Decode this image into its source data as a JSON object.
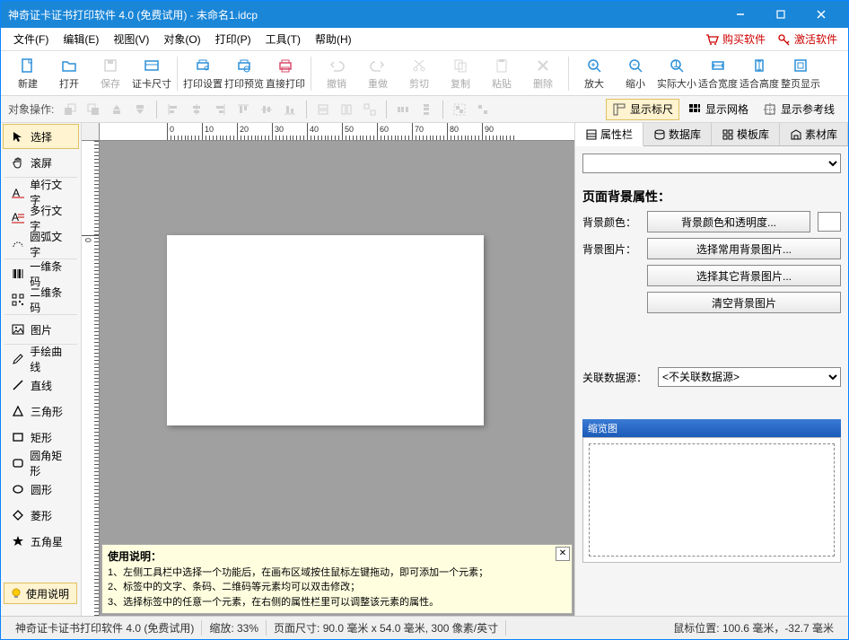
{
  "titlebar": {
    "title": "神奇证卡证书打印软件 4.0 (免费试用) - 未命名1.idcp"
  },
  "menu": {
    "file": "文件(F)",
    "edit": "编辑(E)",
    "view": "视图(V)",
    "object": "对象(O)",
    "print": "打印(P)",
    "tool": "工具(T)",
    "help": "帮助(H)",
    "buy": "购买软件",
    "activate": "激活软件"
  },
  "toolbar": {
    "new": "新建",
    "open": "打开",
    "save": "保存",
    "cardsize": "证卡尺寸",
    "printsetup": "打印设置",
    "printpreview": "打印预览",
    "printnow": "直接打印",
    "undo": "撤销",
    "redo": "重做",
    "cut": "剪切",
    "copy": "复制",
    "paste": "粘贴",
    "delete": "删除",
    "zoomin": "放大",
    "zoomout": "缩小",
    "actualsize": "实际大小",
    "fitwidth": "适合宽度",
    "fitheight": "适合高度",
    "fitpage": "整页显示"
  },
  "secondbar": {
    "label": "对象操作:",
    "showruler": "显示标尺",
    "showgrid": "显示网格",
    "showguide": "显示参考线"
  },
  "lefttools": {
    "select": "选择",
    "hand": "滚屏",
    "text1": "单行文字",
    "text2": "多行文字",
    "arctext": "圆弧文字",
    "barcode": "一维条码",
    "qrcode": "二维条码",
    "image": "图片",
    "freehand": "手绘曲线",
    "line": "直线",
    "triangle": "三角形",
    "rect": "矩形",
    "roundrect": "圆角矩形",
    "circle": "圆形",
    "diamond": "菱形",
    "star": "五角星",
    "help": "使用说明"
  },
  "rightpanel": {
    "tab_prop": "属性栏",
    "tab_db": "数据库",
    "tab_template": "模板库",
    "tab_material": "素材库",
    "prop_title": "页面背景属性：",
    "bgcolor_lbl": "背景颜色：",
    "bgcolor_btn": "背景颜色和透明度...",
    "bgimg_lbl": "背景图片：",
    "bgimg_btn1": "选择常用背景图片...",
    "bgimg_btn2": "选择其它背景图片...",
    "bgimg_clear": "清空背景图片",
    "ds_lbl": "关联数据源：",
    "ds_value": "<不关联数据源>",
    "thumb_title": "缩览图"
  },
  "hint": {
    "title": "使用说明：",
    "l1": "1、左侧工具栏中选择一个功能后，在画布区域按住鼠标左键拖动，即可添加一个元素；",
    "l2": "2、标签中的文字、条码、二维码等元素均可以双击修改；",
    "l3": "3、选择标签中的任意一个元素，在右侧的属性栏里可以调整该元素的属性。"
  },
  "statusbar": {
    "app": "神奇证卡证书打印软件 4.0 (免费试用)",
    "zoom": "缩放: 33%",
    "pagesize": "页面尺寸: 90.0 毫米 x 54.0 毫米, 300 像素/英寸",
    "mousepos": "鼠标位置: 100.6 毫米，-32.7 毫米"
  },
  "ruler_h": [
    "0",
    "10",
    "20",
    "30",
    "40",
    "50",
    "60",
    "70",
    "80",
    "90"
  ],
  "ruler_v": [
    "0"
  ]
}
